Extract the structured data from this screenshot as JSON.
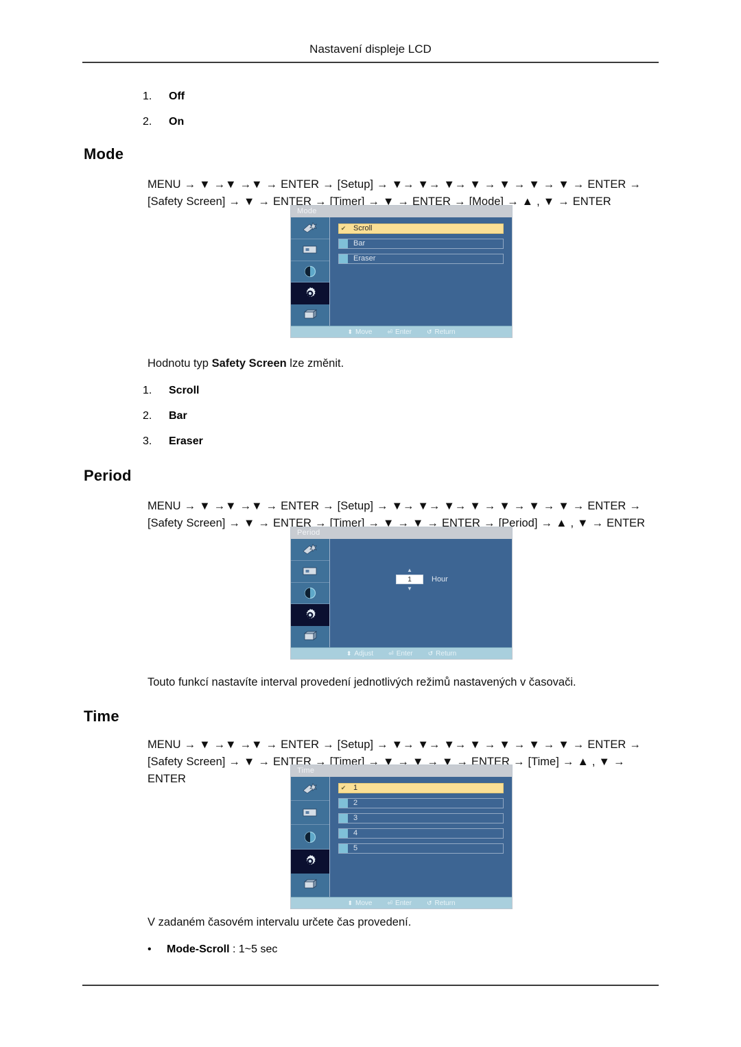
{
  "page": {
    "header": "Nastavení displeje LCD"
  },
  "top_list": {
    "items": [
      {
        "index": "1.",
        "label": "Off"
      },
      {
        "index": "2.",
        "label": "On"
      }
    ]
  },
  "sections": {
    "mode": {
      "title": "Mode",
      "path_line1": "MENU → ▼ →▼ →▼ → ENTER → [Setup] → ▼→ ▼→ ▼→ ▼ → ▼ → ▼ → ▼ → ENTER → [Safety",
      "path_line2": "Screen] → ▼ → ENTER → [Timer] → ▼ → ENTER → [Mode] → ▲ , ▼ → ENTER",
      "caption_pre": "Hodnotu typ ",
      "caption_bold": "Safety Screen",
      "caption_post": " lze změnit.",
      "list": [
        {
          "index": "1.",
          "label": "Scroll"
        },
        {
          "index": "2.",
          "label": "Bar"
        },
        {
          "index": "3.",
          "label": "Eraser"
        }
      ],
      "osd": {
        "title": "Mode",
        "rows": [
          {
            "label": "Scroll",
            "active": true,
            "check": "✔"
          },
          {
            "label": "Bar",
            "active": false,
            "check": ""
          },
          {
            "label": "Eraser",
            "active": false,
            "check": ""
          }
        ],
        "footer": [
          {
            "glyph": "⬍",
            "label": "Move"
          },
          {
            "glyph": "⏎",
            "label": "Enter"
          },
          {
            "glyph": "↺",
            "label": "Return"
          }
        ]
      }
    },
    "period": {
      "title": "Period",
      "path_line1": "MENU → ▼ →▼ →▼ → ENTER → [Setup] → ▼→ ▼→ ▼→ ▼ → ▼ → ▼ → ▼ → ENTER → [Safety",
      "path_line2": "Screen] → ▼ → ENTER → [Timer] → ▼ → ▼ → ENTER → [Period] → ▲ , ▼ → ENTER",
      "description": "Touto funkcí nastavíte interval provedení jednotlivých režimů nastavených v časovači.",
      "osd": {
        "title": "Period",
        "value": "1",
        "unit": "Hour",
        "up_arrow": "▲",
        "down_arrow": "▼",
        "footer": [
          {
            "glyph": "⬍",
            "label": "Adjust"
          },
          {
            "glyph": "⏎",
            "label": "Enter"
          },
          {
            "glyph": "↺",
            "label": "Return"
          }
        ]
      }
    },
    "time": {
      "title": "Time",
      "path_line1": "MENU → ▼ →▼ →▼ → ENTER → [Setup] → ▼→ ▼→ ▼→ ▼ → ▼ → ▼ → ▼ → ENTER → [Safety",
      "path_line2": "Screen] → ▼ → ENTER → [Timer] → ▼ → ▼ → ▼ → ENTER → [Time] → ▲ , ▼ → ENTER",
      "description": "V zadaném časovém intervalu určete čas provedení.",
      "bullet_bold": "Mode-Scroll",
      "bullet_rest": " : 1~5 sec",
      "bullet_dot": "•",
      "osd": {
        "title": "Time",
        "rows": [
          {
            "label": "1",
            "active": true,
            "check": "✔"
          },
          {
            "label": "2",
            "active": false,
            "check": ""
          },
          {
            "label": "3",
            "active": false,
            "check": ""
          },
          {
            "label": "4",
            "active": false,
            "check": ""
          },
          {
            "label": "5",
            "active": false,
            "check": ""
          }
        ],
        "footer": [
          {
            "glyph": "⬍",
            "label": "Move"
          },
          {
            "glyph": "⏎",
            "label": "Enter"
          },
          {
            "glyph": "↺",
            "label": "Return"
          }
        ]
      }
    }
  },
  "osd_sidebar_icons": [
    "picture-tools-icon",
    "screen-icon",
    "color-contrast-icon",
    "setup-gear-icon",
    "multi-control-icon"
  ],
  "colors": {
    "osd_background": "#3d6593",
    "osd_sidebar": "#3f7199",
    "osd_selected_icon": "#0b1030",
    "osd_highlight_row": "#fadf95",
    "osd_footer": "#a9cfdd",
    "osd_titlebar": "#c8ccd2"
  }
}
